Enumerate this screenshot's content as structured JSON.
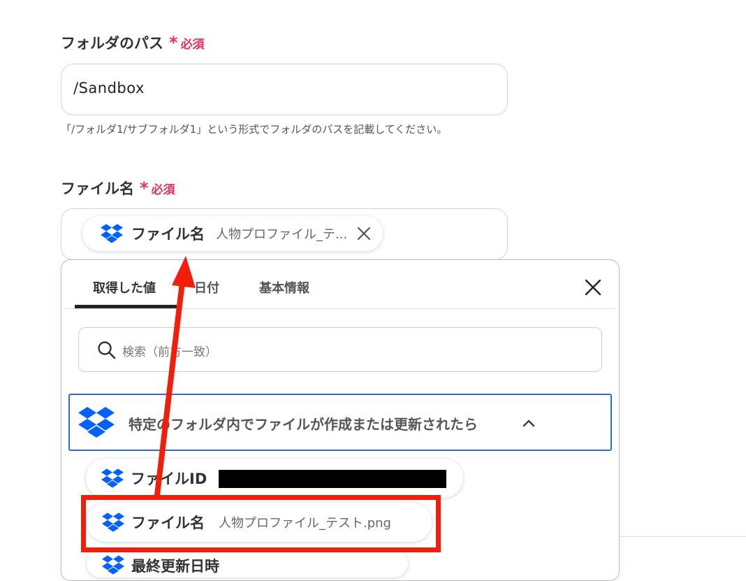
{
  "folder_path": {
    "label": "フォルダのパス",
    "required_mark": "*",
    "required_text": "必須",
    "value": "/Sandbox",
    "hint": "「/フォルダ1/サブフォルダ1」という形式でフォルダのパスを記載してください。"
  },
  "file_name": {
    "label": "ファイル名",
    "required_mark": "*",
    "required_text": "必須",
    "chip": {
      "name": "ファイル名",
      "value": "人物プロファイル_テ..."
    }
  },
  "picker": {
    "tabs": [
      {
        "label": "取得した値",
        "active": true
      },
      {
        "label": "日付",
        "active": false
      },
      {
        "label": "基本情報",
        "active": false
      }
    ],
    "search_placeholder": "検索（前方一致）",
    "group": {
      "title": "特定のフォルダ内でファイルが作成または更新されたら",
      "items": [
        {
          "name": "ファイルID",
          "value": ""
        },
        {
          "name": "ファイル名",
          "value": "人物プロファイル_テスト.png"
        },
        {
          "name": "最終更新日時",
          "value": ""
        }
      ]
    }
  },
  "colors": {
    "required": "#e5315a",
    "dropbox": "#0061fe",
    "group_border": "#2a6fd8",
    "annotation": "#f01e0a"
  },
  "icons": [
    "dropbox-icon",
    "close-icon",
    "search-icon",
    "chevron-up-icon"
  ]
}
